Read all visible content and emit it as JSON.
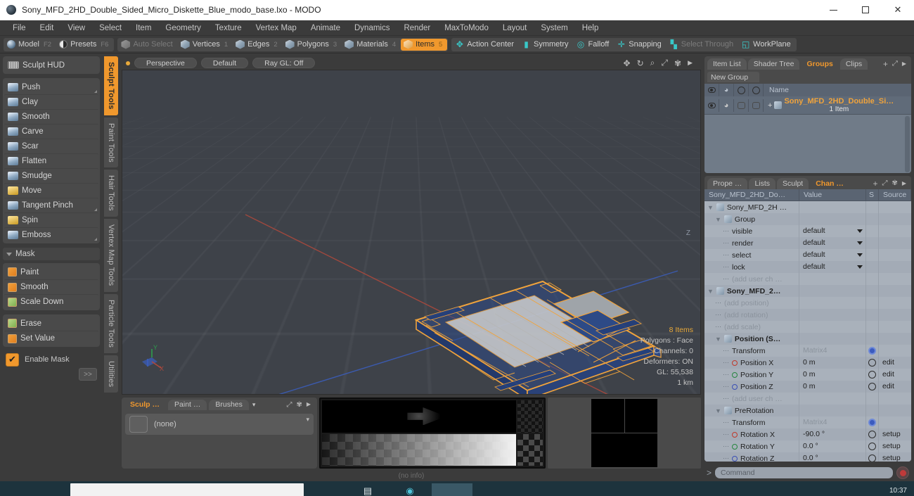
{
  "window": {
    "title": "Sony_MFD_2HD_Double_Sided_Micro_Diskette_Blue_modo_base.lxo - MODO",
    "app_icon": "modo-sphere-icon",
    "minimize": "–",
    "maximize": "□",
    "close": "✕"
  },
  "menubar": [
    "File",
    "Edit",
    "View",
    "Select",
    "Item",
    "Geometry",
    "Texture",
    "Vertex Map",
    "Animate",
    "Dynamics",
    "Render",
    "MaxToModo",
    "Layout",
    "System",
    "Help"
  ],
  "modebar": {
    "left_group": [
      {
        "label": "Model",
        "key": "F2",
        "icon": "sphere-icon",
        "active": false
      },
      {
        "label": "Presets",
        "key": "F6",
        "icon": "half-sphere-icon",
        "active": false
      }
    ],
    "select_group": [
      {
        "label": "Auto Select",
        "key": "",
        "icon": "cube-icon",
        "dim": true
      },
      {
        "label": "Vertices",
        "key": "1",
        "icon": "cube-icon",
        "dim": false
      },
      {
        "label": "Edges",
        "key": "2",
        "icon": "cube-icon",
        "dim": false
      },
      {
        "label": "Polygons",
        "key": "3",
        "icon": "cube-icon",
        "dim": false
      },
      {
        "label": "Materials",
        "key": "4",
        "icon": "cube-icon",
        "dim": false
      },
      {
        "label": "Items",
        "key": "5",
        "icon": "cube-icon",
        "dim": false,
        "active": true
      }
    ],
    "right_group": [
      {
        "label": "Action Center",
        "icon": "action-center-icon",
        "dim": false
      },
      {
        "label": "Symmetry",
        "icon": "symmetry-icon",
        "dim": false
      },
      {
        "label": "Falloff",
        "icon": "falloff-icon",
        "dim": false
      },
      {
        "label": "Snapping",
        "icon": "snapping-icon",
        "dim": false
      },
      {
        "label": "Select Through",
        "icon": "select-through-icon",
        "dim": true
      },
      {
        "label": "WorkPlane",
        "icon": "workplane-icon",
        "dim": false
      }
    ]
  },
  "left_panel": {
    "hud": {
      "label": "Sculpt HUD",
      "icon": "hud-icon"
    },
    "sculpt_tools": [
      {
        "label": "Push",
        "icon": "brush-icon",
        "has_corner": true
      },
      {
        "label": "Clay",
        "icon": "brush-icon"
      },
      {
        "label": "Smooth",
        "icon": "brush-icon"
      },
      {
        "label": "Carve",
        "icon": "brush-icon"
      },
      {
        "label": "Scar",
        "icon": "brush-icon"
      },
      {
        "label": "Flatten",
        "icon": "brush-icon"
      },
      {
        "label": "Smudge",
        "icon": "brush-icon"
      },
      {
        "label": "Move",
        "icon": "brush-yellow-icon"
      },
      {
        "label": "Tangent Pinch",
        "icon": "brush-icon",
        "has_corner": true
      },
      {
        "label": "Spin",
        "icon": "brush-yellow-icon"
      },
      {
        "label": "Emboss",
        "icon": "brush-icon",
        "has_corner": true
      }
    ],
    "mask_section": {
      "label": "Mask"
    },
    "mask_tools": [
      {
        "label": "Paint",
        "icon": "mask-orange-icon"
      },
      {
        "label": "Smooth",
        "icon": "mask-orange-icon"
      },
      {
        "label": "Scale Down",
        "icon": "mask-green-icon"
      }
    ],
    "mask_tools2": [
      {
        "label": "Erase",
        "icon": "mask-green-icon"
      },
      {
        "label": "Set Value",
        "icon": "mask-orange-icon"
      }
    ],
    "enable_mask": {
      "label": "Enable Mask",
      "checked": true,
      "check_glyph": "✔"
    },
    "more_button": ">>"
  },
  "vertical_tabs": [
    {
      "label": "Sculpt Tools",
      "active": true
    },
    {
      "label": "Paint Tools",
      "active": false
    },
    {
      "label": "Hair Tools",
      "active": false
    },
    {
      "label": "Vertex Map Tools",
      "active": false
    },
    {
      "label": "Particle Tools",
      "active": false
    },
    {
      "label": "Utilities",
      "active": false
    }
  ],
  "viewport": {
    "header_buttons": [
      "Perspective",
      "Default",
      "Ray GL: Off"
    ],
    "tool_icons": [
      "move-icon",
      "rotate-icon",
      "zoom-icon",
      "fit-icon",
      "gear-icon",
      "chevron-right-icon"
    ],
    "stats": {
      "items": "8 Items",
      "lines": [
        "Polygons : Face",
        "Channels: 0",
        "Deformers: ON",
        "GL: 55,538",
        "1 km"
      ]
    },
    "axis_labels": {
      "y": "Y",
      "x": "X",
      "z": "Z"
    },
    "colors": {
      "bg": "#3e4249",
      "x_axis": "#b0493c",
      "z_axis": "#3b5fc0",
      "selection": "#f0a33c",
      "mesh": "#2d4a86"
    }
  },
  "bottom_dock": {
    "tabs": [
      {
        "label": "Sculp …",
        "active": true
      },
      {
        "label": "Paint …",
        "active": false
      },
      {
        "label": "Brushes",
        "active": false
      }
    ],
    "dropdown_caret": "▾",
    "icons": [
      "expand-icon",
      "gear-icon",
      "chevron-right-icon"
    ],
    "brush_value": "(none)",
    "status": "(no info)"
  },
  "right_top": {
    "tabs": [
      {
        "label": "Item List",
        "active": false
      },
      {
        "label": "Shader Tree",
        "active": false
      },
      {
        "label": "Groups",
        "active": true
      },
      {
        "label": "Clips",
        "active": false
      }
    ],
    "add_tab": "+",
    "icons": [
      "expand-icon",
      "chevron-right-icon"
    ],
    "new_group_button": "New Group",
    "columns": [
      "eye-icon",
      "render-icon",
      "select-icon",
      "lock-icon",
      "Name"
    ],
    "rows": [
      {
        "expander": "+",
        "icon": "group-icon",
        "name": "Sony_MFD_2HD_Double_Si…",
        "sub": "1 Item"
      }
    ]
  },
  "right_bottom": {
    "tabs": [
      {
        "label": "Prope …",
        "active": false
      },
      {
        "label": "Lists",
        "active": false
      },
      {
        "label": "Sculpt",
        "active": false
      },
      {
        "label": "Chan …",
        "active": true
      }
    ],
    "add_tab": "+",
    "icons": [
      "expand-icon",
      "gear-icon",
      "chevron-right-icon"
    ],
    "columns": [
      "Sony_MFD_2HD_Do…",
      "Value",
      "S",
      "Source"
    ],
    "rows": [
      {
        "indent": 0,
        "tree": "▼",
        "icon": "mesh-icon",
        "name": "Sony_MFD_2H …",
        "value": "",
        "s": "",
        "source": "",
        "bold": false
      },
      {
        "indent": 1,
        "tree": "▼",
        "icon": "mesh-icon",
        "name": "Group",
        "value": "",
        "s": "",
        "source": "",
        "bold": false
      },
      {
        "indent": 2,
        "tree": "dot",
        "icon": "",
        "name": "visible",
        "value": "default",
        "dropdown": true,
        "s": "",
        "source": ""
      },
      {
        "indent": 2,
        "tree": "dot",
        "icon": "",
        "name": "render",
        "value": "default",
        "dropdown": true,
        "s": "",
        "source": ""
      },
      {
        "indent": 2,
        "tree": "dot",
        "icon": "",
        "name": "select",
        "value": "default",
        "dropdown": true,
        "s": "",
        "source": ""
      },
      {
        "indent": 2,
        "tree": "dot",
        "icon": "",
        "name": "lock",
        "value": "default",
        "dropdown": true,
        "s": "",
        "source": ""
      },
      {
        "indent": 2,
        "tree": "dot",
        "icon": "",
        "name": "(add user ch …",
        "value": "",
        "s": "",
        "source": "",
        "gray": true
      },
      {
        "indent": 0,
        "tree": "▼",
        "icon": "locator-icon",
        "name": "Sony_MFD_2…",
        "value": "",
        "s": "",
        "source": "",
        "bold": true
      },
      {
        "indent": 1,
        "tree": "dot",
        "icon": "",
        "name": "(add position)",
        "value": "",
        "s": "",
        "source": "",
        "gray": true
      },
      {
        "indent": 1,
        "tree": "dot",
        "icon": "",
        "name": "(add rotation)",
        "value": "",
        "s": "",
        "source": "",
        "gray": true
      },
      {
        "indent": 1,
        "tree": "dot",
        "icon": "",
        "name": "(add scale)",
        "value": "",
        "s": "",
        "source": "",
        "gray": true
      },
      {
        "indent": 1,
        "tree": "▼",
        "icon": "position-icon",
        "name": "Position (S…",
        "value": "",
        "s": "",
        "source": "",
        "bold": true
      },
      {
        "indent": 2,
        "tree": "dot",
        "icon": "",
        "name": "Transform",
        "value": "Matrix4",
        "s": "gear",
        "source": "",
        "grayval": true
      },
      {
        "indent": 2,
        "tree": "dot",
        "icon": "ring-r",
        "name": "Position X",
        "value": "0 m",
        "s": "circle",
        "source": "edit"
      },
      {
        "indent": 2,
        "tree": "dot",
        "icon": "ring-g",
        "name": "Position Y",
        "value": "0 m",
        "s": "circle",
        "source": "edit"
      },
      {
        "indent": 2,
        "tree": "dot",
        "icon": "ring-b",
        "name": "Position Z",
        "value": "0 m",
        "s": "circle",
        "source": "edit"
      },
      {
        "indent": 2,
        "tree": "dot",
        "icon": "",
        "name": "(add user ch …",
        "value": "",
        "s": "",
        "source": "",
        "gray": true
      },
      {
        "indent": 1,
        "tree": "▼",
        "icon": "prerotation-icon",
        "name": "PreRotation",
        "value": "",
        "s": "",
        "source": ""
      },
      {
        "indent": 2,
        "tree": "dot",
        "icon": "",
        "name": "Transform",
        "value": "Matrix4",
        "s": "gear",
        "source": "",
        "grayval": true
      },
      {
        "indent": 2,
        "tree": "dot",
        "icon": "ring-r",
        "name": "Rotation X",
        "value": "-90.0 °",
        "s": "circle",
        "source": "setup"
      },
      {
        "indent": 2,
        "tree": "dot",
        "icon": "ring-g",
        "name": "Rotation Y",
        "value": "0.0 °",
        "s": "circle",
        "source": "setup"
      },
      {
        "indent": 2,
        "tree": "dot",
        "icon": "ring-b",
        "name": "Rotation Z",
        "value": "0.0 °",
        "s": "circle",
        "source": "setup"
      }
    ]
  },
  "command_bar": {
    "prompt": ">",
    "placeholder": "Command",
    "record_button": "record-icon"
  },
  "taskbar": {
    "time": "10:37"
  }
}
